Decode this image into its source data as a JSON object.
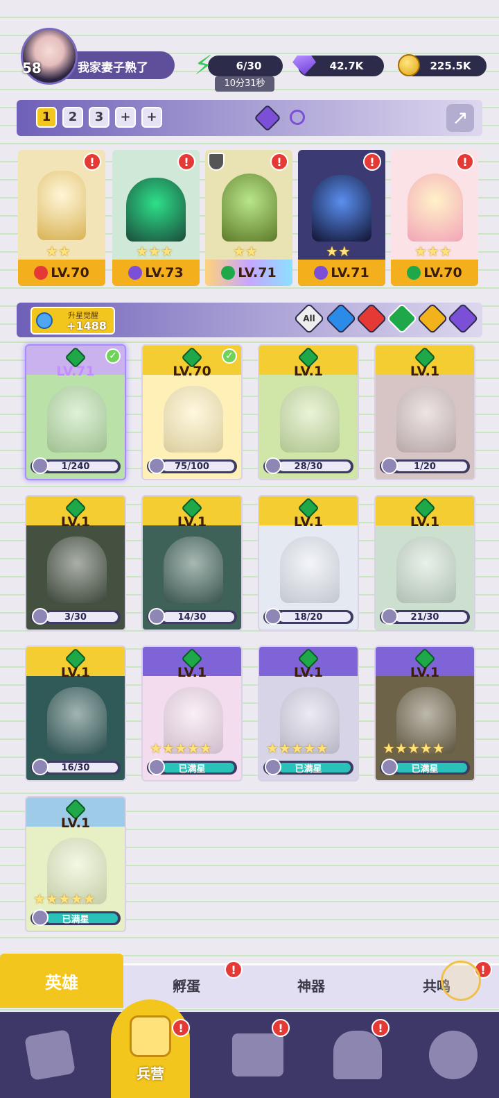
{
  "profile": {
    "level": "58",
    "name": "我家妻子熟了"
  },
  "resources": {
    "energy": {
      "value": "6/30",
      "timer": "10分31秒",
      "icon": "energy-bolt-icon"
    },
    "gems": {
      "value": "42.7K",
      "icon": "gem-icon"
    },
    "coins": {
      "value": "225.5K",
      "icon": "coin-icon"
    }
  },
  "teams": {
    "tabs": [
      "1",
      "2",
      "3",
      "+",
      "+"
    ],
    "selected": "1"
  },
  "team_heroes": [
    {
      "level": "LV.70",
      "element": "fire",
      "stars": 2,
      "color": "#f2e4b6"
    },
    {
      "level": "LV.73",
      "element": "dark",
      "stars": 3,
      "color": "#cfe8d8"
    },
    {
      "level": "LV.71",
      "element": "nature",
      "stars": 2,
      "color": "#e9e3b4"
    },
    {
      "level": "LV.71",
      "element": "dark",
      "stars": 2,
      "color": "#3c3a72"
    },
    {
      "level": "LV.70",
      "element": "nature",
      "stars": 3,
      "color": "#fbe2e6"
    }
  ],
  "upgrade": {
    "label": "升星觉醒",
    "value": "+1488"
  },
  "filters": [
    "All",
    "water",
    "fire",
    "nature",
    "light",
    "dark"
  ],
  "heroes": [
    {
      "level": "LV.71",
      "progress": "1/240",
      "color": "#b9e1a8",
      "top": "#cab2ef"
    },
    {
      "level": "LV.70",
      "progress": "75/100",
      "color": "#fff0b8",
      "top": "#f4cd32"
    },
    {
      "level": "LV.1",
      "progress": "28/30",
      "color": "#cfe6a8",
      "top": "#f4cd32"
    },
    {
      "level": "LV.1",
      "progress": "1/20",
      "color": "#d7c4c4",
      "top": "#f4cd32"
    },
    {
      "level": "LV.1",
      "progress": "3/30",
      "color": "#445040",
      "top": "#f4cd32"
    },
    {
      "level": "LV.1",
      "progress": "14/30",
      "color": "#3f6258",
      "top": "#f4cd32"
    },
    {
      "level": "LV.1",
      "progress": "18/20",
      "color": "#e4e9f2",
      "top": "#f4cd32"
    },
    {
      "level": "LV.1",
      "progress": "21/30",
      "color": "#cde0d0",
      "top": "#f4cd32"
    },
    {
      "level": "LV.1",
      "progress": "16/30",
      "color": "#2f5a58",
      "top": "#f4cd32"
    },
    {
      "level": "LV.1",
      "progress": "已满星",
      "color": "#f3dcee",
      "top": "#7f64d8"
    },
    {
      "level": "LV.1",
      "progress": "已满星",
      "color": "#d6d4e6",
      "top": "#7f64d8"
    },
    {
      "level": "LV.1",
      "progress": "已满星",
      "color": "#6d6348",
      "top": "#7f64d8"
    },
    {
      "level": "LV.1",
      "progress": "已满星",
      "color": "#e6f0c4",
      "top": "#9ecbe8"
    }
  ],
  "tabs": {
    "heroes": "英雄",
    "eggs": "孵蛋",
    "artifacts": "神器",
    "resonance": "共鸣"
  },
  "nav": {
    "barracks": "兵营"
  }
}
